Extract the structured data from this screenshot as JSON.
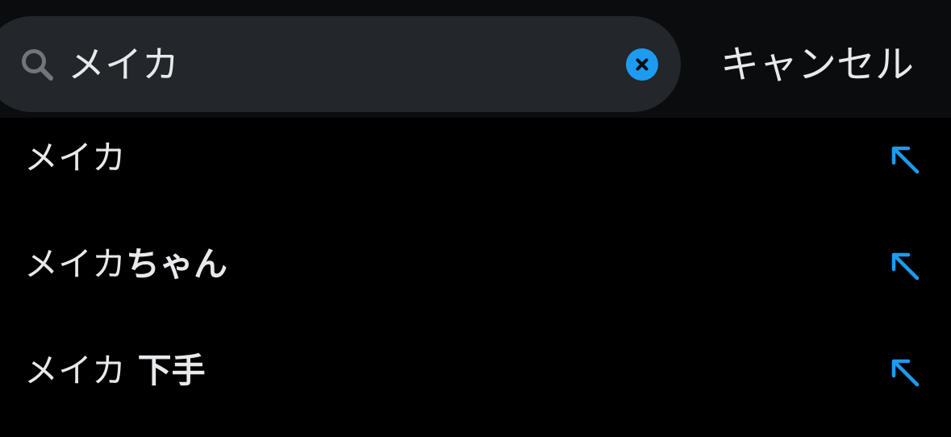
{
  "search": {
    "value": "メイカ",
    "cancel_label": "キャンセル"
  },
  "suggestions": [
    {
      "prefix": "メイカ",
      "suffix": ""
    },
    {
      "prefix": "メイカ",
      "suffix": "ちゃん"
    },
    {
      "prefix": "メイカ",
      "suffix": " 下手"
    }
  ],
  "icons": {
    "search": "search-icon",
    "clear": "clear-icon",
    "fill": "arrow-up-left-icon"
  },
  "colors": {
    "accent": "#1d9bf0",
    "background": "#000000",
    "search_field": "#23262b",
    "text": "#e7e9ea",
    "icon_muted": "#71767b"
  }
}
